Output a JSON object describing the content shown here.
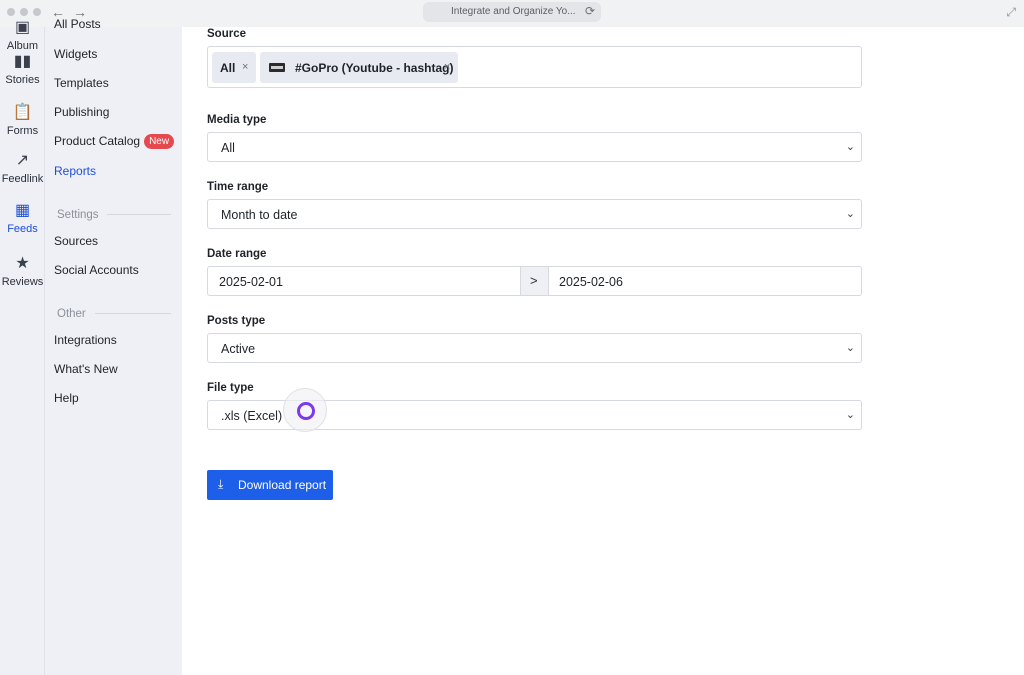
{
  "browser": {
    "back_glyph": "←",
    "forward_glyph": "→",
    "tab_title": "Integrate and Organize Yo...",
    "reload_glyph": "⟳",
    "expand_glyph": "⤢"
  },
  "rail": {
    "items": [
      {
        "label": "Album",
        "icon": "album-icon",
        "glyph": "▣"
      },
      {
        "label": "Stories",
        "icon": "stories-icon",
        "glyph": "▮▮"
      },
      {
        "label": "Forms",
        "icon": "clipboard-icon",
        "glyph": "📋"
      },
      {
        "label": "Feedlink",
        "icon": "arrow-up-right-icon",
        "glyph": "↗"
      },
      {
        "label": "Feeds",
        "icon": "grid-icon",
        "glyph": "▦"
      },
      {
        "label": "Reviews",
        "icon": "star-icon",
        "glyph": "★"
      }
    ]
  },
  "sidebar": {
    "items": [
      {
        "label": "All Posts"
      },
      {
        "label": "Widgets"
      },
      {
        "label": "Templates"
      },
      {
        "label": "Publishing"
      },
      {
        "label": "Product Catalog",
        "badge": "New"
      },
      {
        "label": "Reports"
      }
    ],
    "settings_heading": "Settings",
    "settings_items": [
      {
        "label": "Sources"
      },
      {
        "label": "Social Accounts"
      }
    ],
    "other_heading": "Other",
    "other_items": [
      {
        "label": "Integrations"
      },
      {
        "label": "What's New"
      },
      {
        "label": "Help"
      }
    ]
  },
  "form": {
    "source_label": "Source",
    "source_tags": [
      {
        "label": "All"
      },
      {
        "label": "#GoPro (Youtube - hashtag)"
      }
    ],
    "tag_remove_glyph": "×",
    "media_type_label": "Media type",
    "media_type_value": "All",
    "time_range_label": "Time range",
    "time_range_value": "Month to date",
    "date_range_label": "Date range",
    "date_from": "2025-02-01",
    "date_separator_glyph": ">",
    "date_to": "2025-02-06",
    "posts_type_label": "Posts type",
    "posts_type_value": "Active",
    "file_type_label": "File type",
    "file_type_value": ".xls (Excel)",
    "chevron_glyph": "⌄",
    "download_label": "Download report",
    "download_glyph": "⤓"
  },
  "colors": {
    "accent": "#1d5fe8",
    "active_nav": "#1d4ed8",
    "badge": "#e5484d",
    "sidebar_bg": "#eef0f6"
  }
}
